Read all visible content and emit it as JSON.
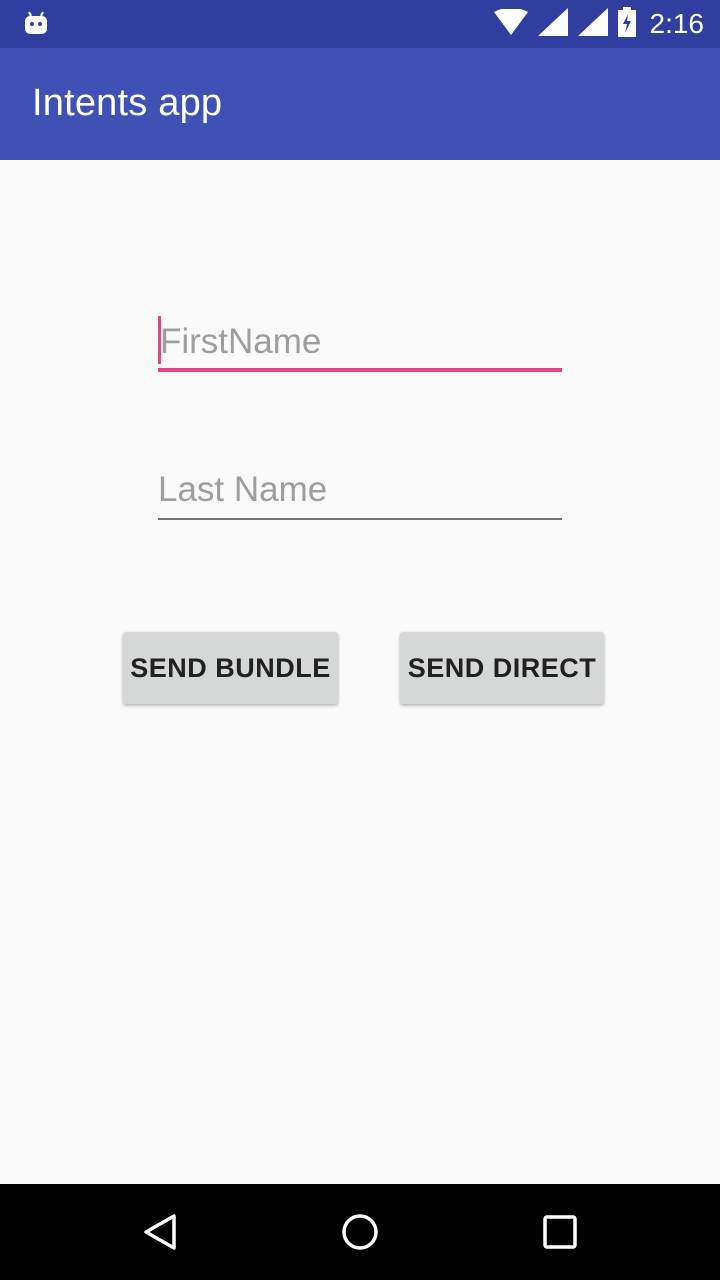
{
  "status_bar": {
    "time": "2:16",
    "left_icon": "android-debug-icon",
    "icons": [
      "wifi-icon",
      "signal-icon",
      "signal-icon",
      "battery-charging-icon"
    ]
  },
  "app_bar": {
    "title": "Intents app",
    "color": "#3f51b5"
  },
  "form": {
    "first_name": {
      "value": "",
      "placeholder": "FirstName",
      "focused": true
    },
    "last_name": {
      "value": "",
      "placeholder": "Last Name",
      "focused": false
    },
    "accent_color": "#e94184"
  },
  "buttons": {
    "send_bundle": "SEND BUNDLE",
    "send_direct": "SEND DIRECT"
  },
  "nav_bar": {
    "back": "back-icon",
    "home": "home-icon",
    "recents": "recents-icon"
  }
}
